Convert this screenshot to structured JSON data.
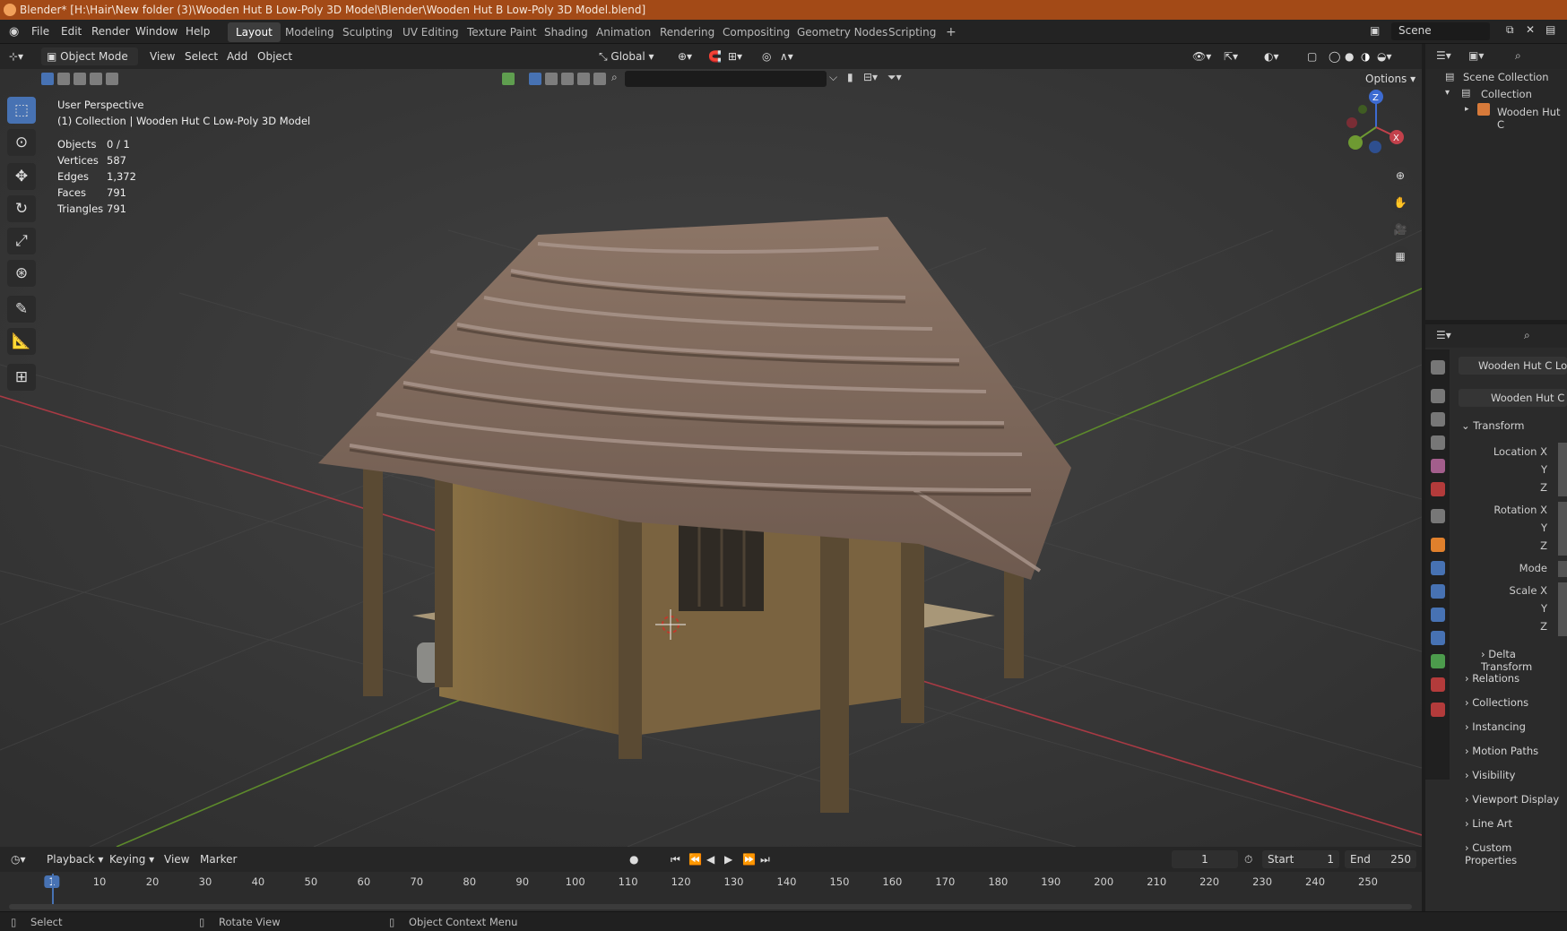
{
  "window_title": "Blender* [H:\\Hair\\New folder (3)\\Wooden Hut B Low-Poly 3D Model\\Blender\\Wooden Hut B Low-Poly 3D Model.blend]",
  "menu": [
    "File",
    "Edit",
    "Render",
    "Window",
    "Help"
  ],
  "workspaces": [
    "Layout",
    "Modeling",
    "Sculpting",
    "UV Editing",
    "Texture Paint",
    "Shading",
    "Animation",
    "Rendering",
    "Compositing",
    "Geometry Nodes",
    "Scripting"
  ],
  "active_workspace": "Layout",
  "add_workspace": "+",
  "scene_name": "Scene",
  "viewport_header": {
    "mode": "Object Mode",
    "menus": [
      "View",
      "Select",
      "Add",
      "Object"
    ],
    "orientation": "Global",
    "options": "Options"
  },
  "viewport": {
    "perspective": "User Perspective",
    "collection": "(1) Collection | Wooden Hut C Low-Poly 3D Model",
    "stats": [
      {
        "label": "Objects",
        "value": "0 / 1"
      },
      {
        "label": "Vertices",
        "value": "587"
      },
      {
        "label": "Edges",
        "value": "1,372"
      },
      {
        "label": "Faces",
        "value": "791"
      },
      {
        "label": "Triangles",
        "value": "791"
      }
    ],
    "axis_labels": {
      "z": "Z",
      "y": "Y",
      "x": "X"
    }
  },
  "outliner": {
    "scene_collection": "Scene Collection",
    "collection": "Collection",
    "object": "Wooden Hut C"
  },
  "properties": {
    "object_name": "Wooden Hut C Low-",
    "data_name": "Wooden Hut C Lo",
    "transform": "Transform",
    "location_x": "Location X",
    "rotation_x": "Rotation X",
    "scale_x": "Scale X",
    "y": "Y",
    "z": "Z",
    "mode": "Mode",
    "delta_transform": "Delta Transform",
    "sections": [
      "Relations",
      "Collections",
      "Instancing",
      "Motion Paths",
      "Visibility",
      "Viewport Display",
      "Line Art",
      "Custom Properties"
    ]
  },
  "timeline": {
    "menus": [
      "Playback",
      "Keying",
      "View",
      "Marker"
    ],
    "current_frame": "1",
    "start_label": "Start",
    "start_value": "1",
    "end_label": "End",
    "end_value": "250",
    "ticks": [
      "1",
      "10",
      "20",
      "30",
      "40",
      "50",
      "60",
      "70",
      "80",
      "90",
      "100",
      "110",
      "120",
      "130",
      "140",
      "150",
      "160",
      "170",
      "180",
      "190",
      "200",
      "210",
      "220",
      "230",
      "240",
      "250"
    ]
  },
  "statusbar": {
    "select": "Select",
    "rotate": "Rotate View",
    "context": "Object Context Menu"
  },
  "colors": {
    "titlebar": "#a34a17",
    "accent": "#4772b3",
    "x_axis": "#c2414b",
    "y_axis": "#6e9a32"
  }
}
